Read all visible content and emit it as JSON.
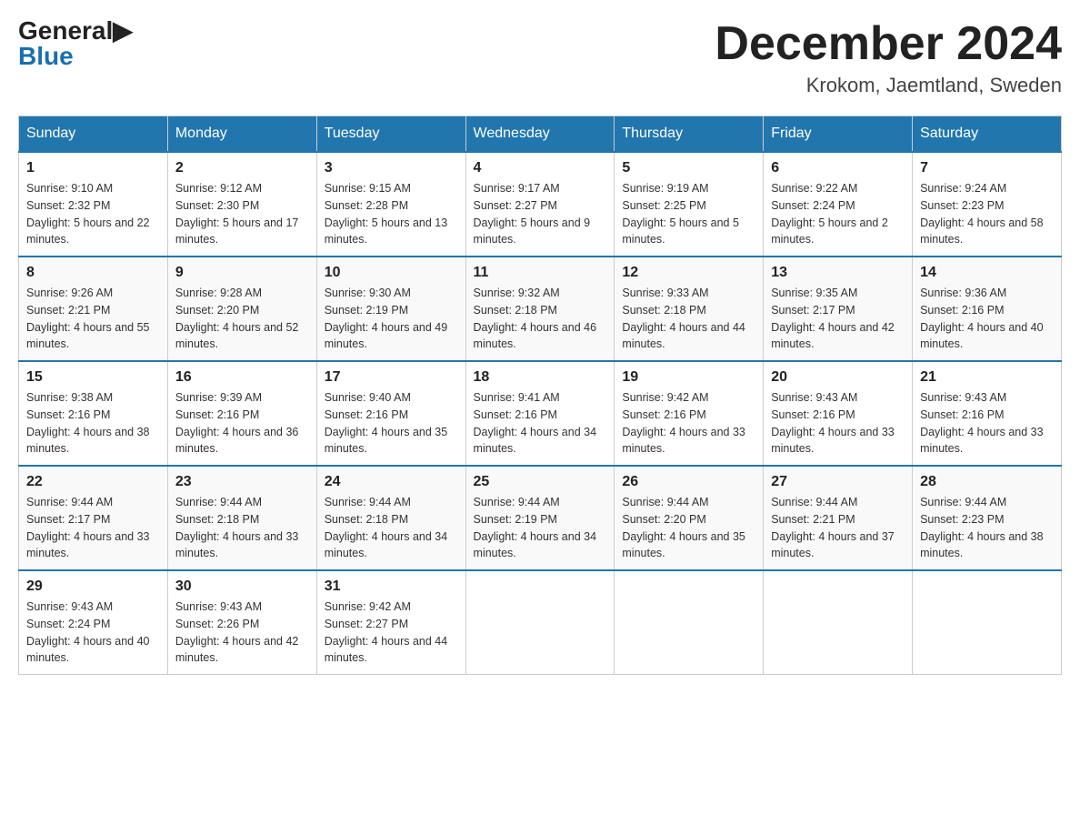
{
  "logo": {
    "general": "General",
    "blue": "Blue"
  },
  "title": {
    "month_year": "December 2024",
    "location": "Krokom, Jaemtland, Sweden"
  },
  "headers": [
    "Sunday",
    "Monday",
    "Tuesday",
    "Wednesday",
    "Thursday",
    "Friday",
    "Saturday"
  ],
  "weeks": [
    [
      {
        "day": "1",
        "sunrise": "Sunrise: 9:10 AM",
        "sunset": "Sunset: 2:32 PM",
        "daylight": "Daylight: 5 hours and 22 minutes."
      },
      {
        "day": "2",
        "sunrise": "Sunrise: 9:12 AM",
        "sunset": "Sunset: 2:30 PM",
        "daylight": "Daylight: 5 hours and 17 minutes."
      },
      {
        "day": "3",
        "sunrise": "Sunrise: 9:15 AM",
        "sunset": "Sunset: 2:28 PM",
        "daylight": "Daylight: 5 hours and 13 minutes."
      },
      {
        "day": "4",
        "sunrise": "Sunrise: 9:17 AM",
        "sunset": "Sunset: 2:27 PM",
        "daylight": "Daylight: 5 hours and 9 minutes."
      },
      {
        "day": "5",
        "sunrise": "Sunrise: 9:19 AM",
        "sunset": "Sunset: 2:25 PM",
        "daylight": "Daylight: 5 hours and 5 minutes."
      },
      {
        "day": "6",
        "sunrise": "Sunrise: 9:22 AM",
        "sunset": "Sunset: 2:24 PM",
        "daylight": "Daylight: 5 hours and 2 minutes."
      },
      {
        "day": "7",
        "sunrise": "Sunrise: 9:24 AM",
        "sunset": "Sunset: 2:23 PM",
        "daylight": "Daylight: 4 hours and 58 minutes."
      }
    ],
    [
      {
        "day": "8",
        "sunrise": "Sunrise: 9:26 AM",
        "sunset": "Sunset: 2:21 PM",
        "daylight": "Daylight: 4 hours and 55 minutes."
      },
      {
        "day": "9",
        "sunrise": "Sunrise: 9:28 AM",
        "sunset": "Sunset: 2:20 PM",
        "daylight": "Daylight: 4 hours and 52 minutes."
      },
      {
        "day": "10",
        "sunrise": "Sunrise: 9:30 AM",
        "sunset": "Sunset: 2:19 PM",
        "daylight": "Daylight: 4 hours and 49 minutes."
      },
      {
        "day": "11",
        "sunrise": "Sunrise: 9:32 AM",
        "sunset": "Sunset: 2:18 PM",
        "daylight": "Daylight: 4 hours and 46 minutes."
      },
      {
        "day": "12",
        "sunrise": "Sunrise: 9:33 AM",
        "sunset": "Sunset: 2:18 PM",
        "daylight": "Daylight: 4 hours and 44 minutes."
      },
      {
        "day": "13",
        "sunrise": "Sunrise: 9:35 AM",
        "sunset": "Sunset: 2:17 PM",
        "daylight": "Daylight: 4 hours and 42 minutes."
      },
      {
        "day": "14",
        "sunrise": "Sunrise: 9:36 AM",
        "sunset": "Sunset: 2:16 PM",
        "daylight": "Daylight: 4 hours and 40 minutes."
      }
    ],
    [
      {
        "day": "15",
        "sunrise": "Sunrise: 9:38 AM",
        "sunset": "Sunset: 2:16 PM",
        "daylight": "Daylight: 4 hours and 38 minutes."
      },
      {
        "day": "16",
        "sunrise": "Sunrise: 9:39 AM",
        "sunset": "Sunset: 2:16 PM",
        "daylight": "Daylight: 4 hours and 36 minutes."
      },
      {
        "day": "17",
        "sunrise": "Sunrise: 9:40 AM",
        "sunset": "Sunset: 2:16 PM",
        "daylight": "Daylight: 4 hours and 35 minutes."
      },
      {
        "day": "18",
        "sunrise": "Sunrise: 9:41 AM",
        "sunset": "Sunset: 2:16 PM",
        "daylight": "Daylight: 4 hours and 34 minutes."
      },
      {
        "day": "19",
        "sunrise": "Sunrise: 9:42 AM",
        "sunset": "Sunset: 2:16 PM",
        "daylight": "Daylight: 4 hours and 33 minutes."
      },
      {
        "day": "20",
        "sunrise": "Sunrise: 9:43 AM",
        "sunset": "Sunset: 2:16 PM",
        "daylight": "Daylight: 4 hours and 33 minutes."
      },
      {
        "day": "21",
        "sunrise": "Sunrise: 9:43 AM",
        "sunset": "Sunset: 2:16 PM",
        "daylight": "Daylight: 4 hours and 33 minutes."
      }
    ],
    [
      {
        "day": "22",
        "sunrise": "Sunrise: 9:44 AM",
        "sunset": "Sunset: 2:17 PM",
        "daylight": "Daylight: 4 hours and 33 minutes."
      },
      {
        "day": "23",
        "sunrise": "Sunrise: 9:44 AM",
        "sunset": "Sunset: 2:18 PM",
        "daylight": "Daylight: 4 hours and 33 minutes."
      },
      {
        "day": "24",
        "sunrise": "Sunrise: 9:44 AM",
        "sunset": "Sunset: 2:18 PM",
        "daylight": "Daylight: 4 hours and 34 minutes."
      },
      {
        "day": "25",
        "sunrise": "Sunrise: 9:44 AM",
        "sunset": "Sunset: 2:19 PM",
        "daylight": "Daylight: 4 hours and 34 minutes."
      },
      {
        "day": "26",
        "sunrise": "Sunrise: 9:44 AM",
        "sunset": "Sunset: 2:20 PM",
        "daylight": "Daylight: 4 hours and 35 minutes."
      },
      {
        "day": "27",
        "sunrise": "Sunrise: 9:44 AM",
        "sunset": "Sunset: 2:21 PM",
        "daylight": "Daylight: 4 hours and 37 minutes."
      },
      {
        "day": "28",
        "sunrise": "Sunrise: 9:44 AM",
        "sunset": "Sunset: 2:23 PM",
        "daylight": "Daylight: 4 hours and 38 minutes."
      }
    ],
    [
      {
        "day": "29",
        "sunrise": "Sunrise: 9:43 AM",
        "sunset": "Sunset: 2:24 PM",
        "daylight": "Daylight: 4 hours and 40 minutes."
      },
      {
        "day": "30",
        "sunrise": "Sunrise: 9:43 AM",
        "sunset": "Sunset: 2:26 PM",
        "daylight": "Daylight: 4 hours and 42 minutes."
      },
      {
        "day": "31",
        "sunrise": "Sunrise: 9:42 AM",
        "sunset": "Sunset: 2:27 PM",
        "daylight": "Daylight: 4 hours and 44 minutes."
      },
      null,
      null,
      null,
      null
    ]
  ]
}
